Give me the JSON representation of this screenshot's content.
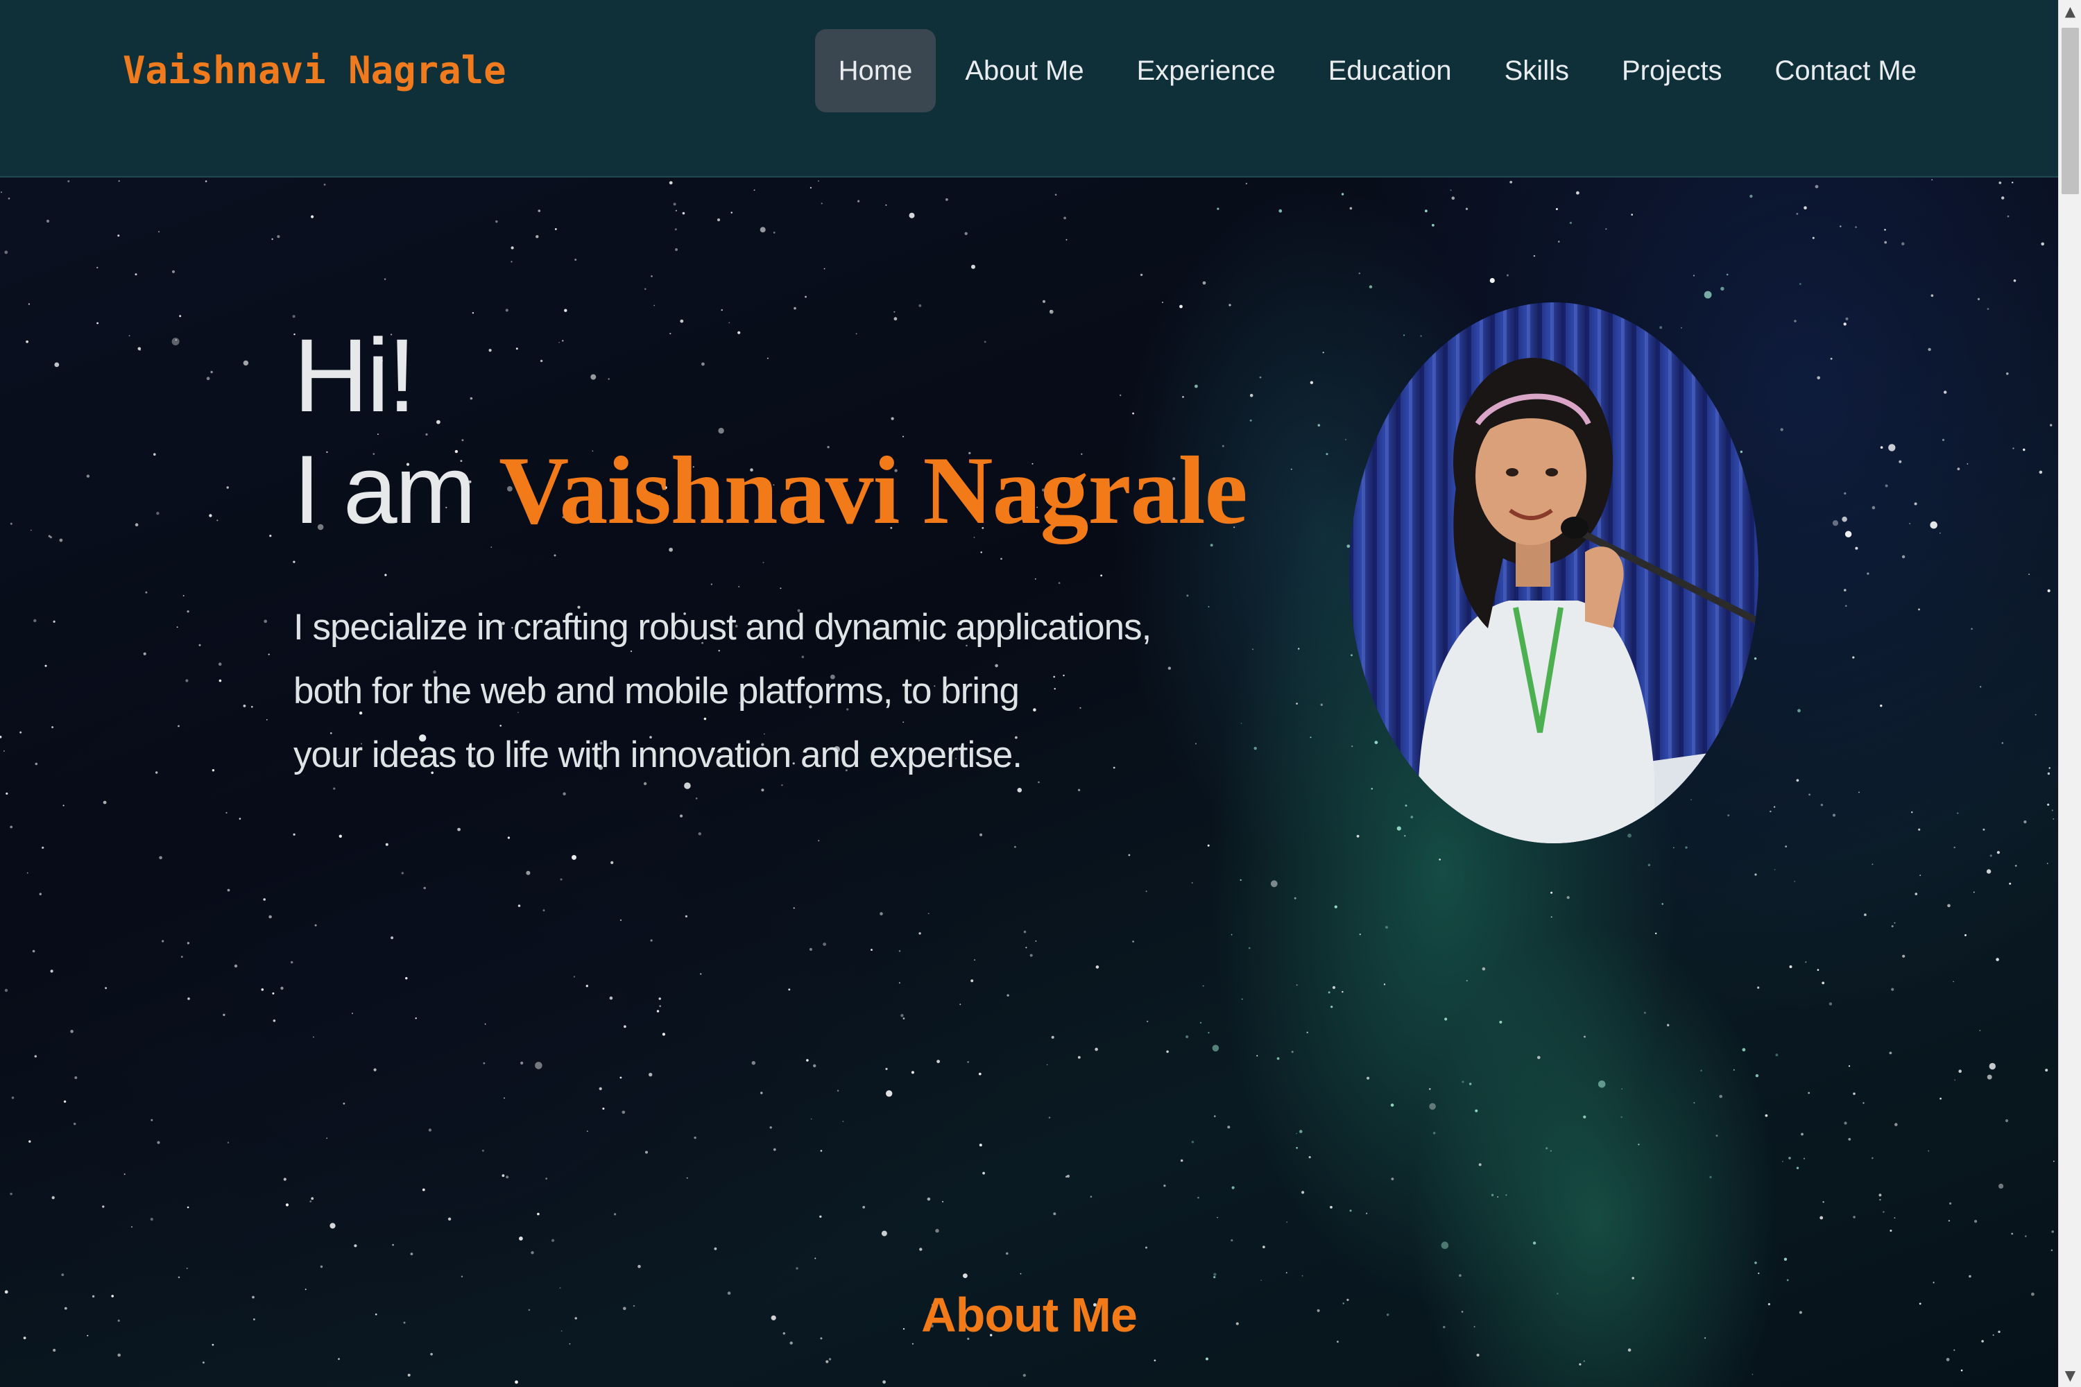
{
  "brand": "Vaishnavi Nagrale",
  "nav": {
    "items": [
      {
        "label": "Home",
        "active": true
      },
      {
        "label": "About Me",
        "active": false
      },
      {
        "label": "Experience",
        "active": false
      },
      {
        "label": "Education",
        "active": false
      },
      {
        "label": "Skills",
        "active": false
      },
      {
        "label": "Projects",
        "active": false
      },
      {
        "label": "Contact Me",
        "active": false
      }
    ]
  },
  "hero": {
    "greeting": "Hi!",
    "intro_prefix": "I am ",
    "name": "Vaishnavi Nagrale",
    "description_lines": [
      "I specialize in crafting robust and dynamic applications,",
      "both for the web and mobile platforms, to bring",
      "your ideas to life with innovation and expertise."
    ]
  },
  "about": {
    "heading": "About Me"
  },
  "scrollbar": {
    "up_icon": "arrow-up-icon",
    "down_icon": "arrow-down-icon"
  },
  "colors": {
    "accent": "#f27a18",
    "navbar_bg": "#0f3038",
    "nav_active_bg": "#3a4650",
    "text": "#e6e8ea"
  }
}
